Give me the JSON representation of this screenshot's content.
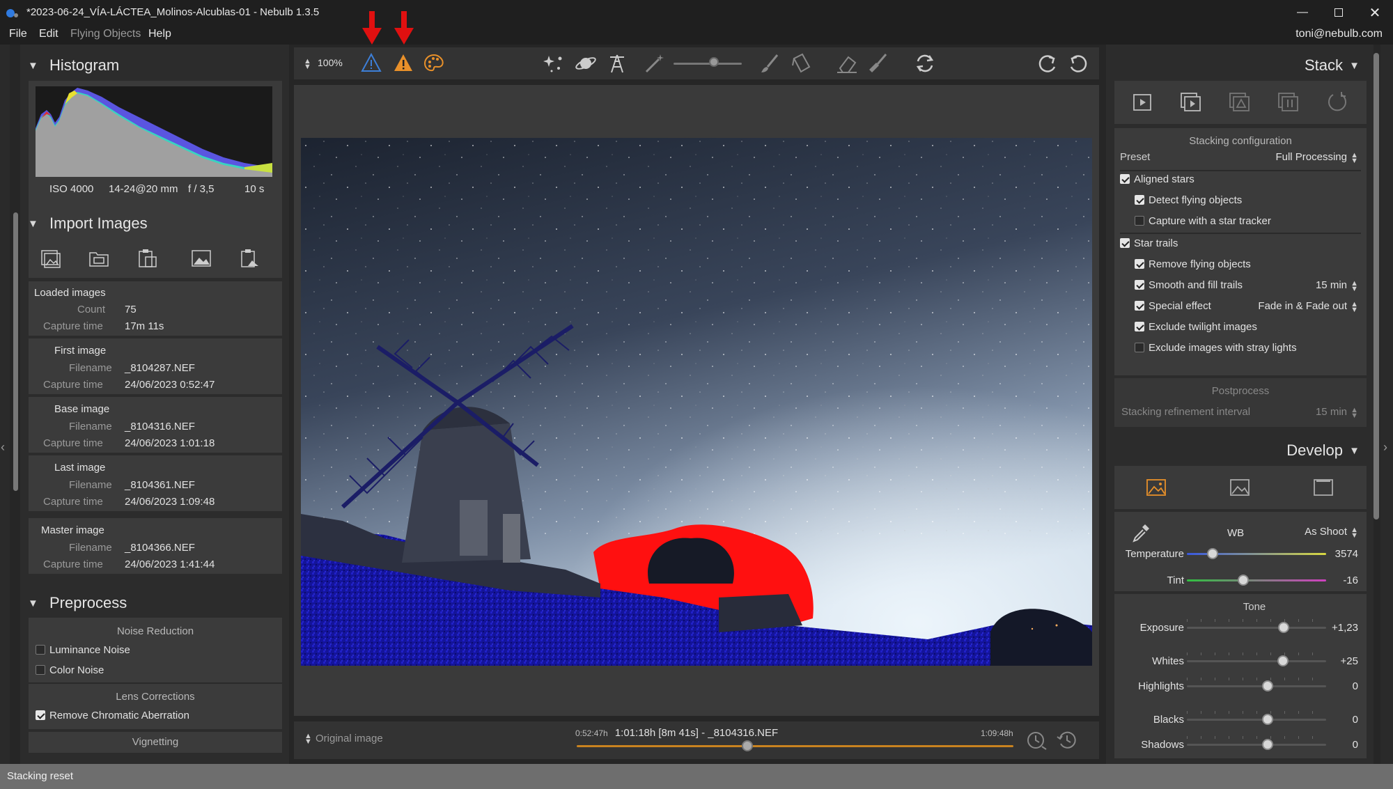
{
  "window": {
    "title": "*2023-06-24_VÍA-LÁCTEA_Molinos-Alcublas-01 - Nebulb 1.3.5"
  },
  "menu": {
    "file": "File",
    "edit": "Edit",
    "flying_objects": "Flying Objects",
    "help": "Help",
    "user": "toni@nebulb.com"
  },
  "toolbar": {
    "zoom": "100%"
  },
  "histogram": {
    "title": "Histogram",
    "iso": "ISO 4000",
    "lens": "14-24@20 mm",
    "aperture": "f / 3,5",
    "exposure": "10 s"
  },
  "import": {
    "title": "Import Images",
    "loaded": {
      "heading": "Loaded images",
      "count_label": "Count",
      "count": "75",
      "capture_label": "Capture time",
      "capture": "17m 11s"
    },
    "first": {
      "heading": "First image",
      "file_label": "Filename",
      "file": "_8104287.NEF",
      "capture_label": "Capture time",
      "capture": "24/06/2023 0:52:47"
    },
    "base": {
      "heading": "Base image",
      "file_label": "Filename",
      "file": "_8104316.NEF",
      "capture_label": "Capture time",
      "capture": "24/06/2023 1:01:18"
    },
    "last": {
      "heading": "Last image",
      "file_label": "Filename",
      "file": "_8104361.NEF",
      "capture_label": "Capture time",
      "capture": "24/06/2023 1:09:48"
    },
    "master": {
      "heading": "Master image",
      "file_label": "Filename",
      "file": "_8104366.NEF",
      "capture_label": "Capture time",
      "capture": "24/06/2023 1:41:44"
    }
  },
  "preprocess": {
    "title": "Preprocess",
    "noise_reduction": "Noise Reduction",
    "luminance": "Luminance Noise",
    "color_noise": "Color Noise",
    "lens_corrections": "Lens Corrections",
    "chromatic": "Remove Chromatic Aberration",
    "vignetting": "Vignetting",
    "luminance_checked": false,
    "color_checked": false,
    "chromatic_checked": true
  },
  "timeline": {
    "view_select": "Original image",
    "start": "0:52:47h",
    "current": "1:01:18h [8m 41s] - _8104316.NEF",
    "end": "1:09:48h",
    "position": 0.39
  },
  "stack": {
    "title": "Stack",
    "config_title": "Stacking configuration",
    "preset_label": "Preset",
    "preset_value": "Full Processing",
    "aligned_stars": "Aligned stars",
    "detect_flying": "Detect flying objects",
    "star_tracker": "Capture with a star tracker",
    "star_trails": "Star trails",
    "remove_flying": "Remove flying objects",
    "smooth_fill": "Smooth and fill trails",
    "smooth_value": "15 min",
    "special_effect": "Special effect",
    "special_value": "Fade in & Fade out",
    "exclude_twilight": "Exclude twilight images",
    "exclude_stray": "Exclude images with stray lights",
    "postprocess": "Postprocess",
    "refinement_label": "Stacking refinement interval",
    "refinement_value": "15 min"
  },
  "develop": {
    "title": "Develop",
    "wb_label": "WB",
    "wb_value": "As Shoot",
    "temperature_label": "Temperature",
    "temperature_value": "3574",
    "tint_label": "Tint",
    "tint_value": "-16",
    "tone_label": "Tone",
    "exposure_label": "Exposure",
    "exposure_value": "+1,23",
    "whites_label": "Whites",
    "whites_value": "+25",
    "highlights_label": "Highlights",
    "highlights_value": "0",
    "blacks_label": "Blacks",
    "blacks_value": "0",
    "shadows_label": "Shadows",
    "shadows_value": "0"
  },
  "status": {
    "text": "Stacking reset"
  },
  "colors": {
    "accent": "#e8902a",
    "warning_blue": "#3d7fd8",
    "warning_orange": "#e8902a",
    "arrow_red": "#e01010",
    "overexposed": "#ff0000",
    "underexposed": "#1a1aa0"
  }
}
